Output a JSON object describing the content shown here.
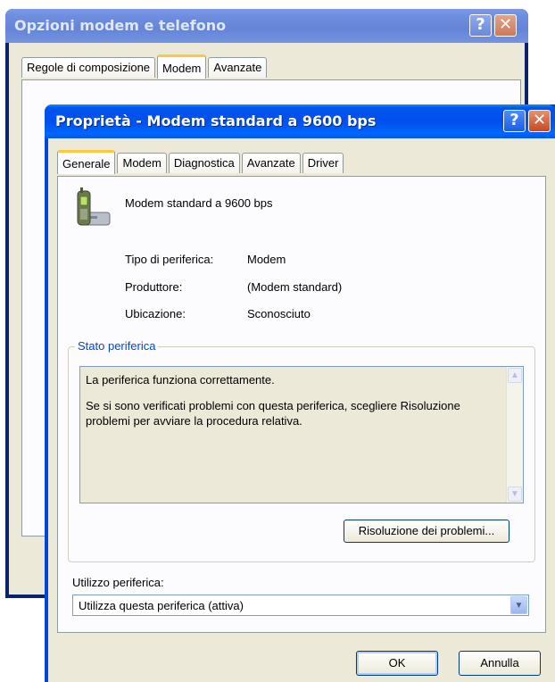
{
  "back_window": {
    "title": "Opzioni modem e telefono",
    "help_glyph": "?",
    "close_glyph": "✕",
    "tabs": [
      "Regole di composizione",
      "Modem",
      "Avanzate"
    ],
    "active_tab": "Modem"
  },
  "dialog": {
    "title": "Proprietà - Modem standard a 9600 bps",
    "help_glyph": "?",
    "close_glyph": "✕",
    "tabs": [
      "Generale",
      "Modem",
      "Diagnostica",
      "Avanzate",
      "Driver"
    ],
    "active_tab": "Generale",
    "device_icon": "modem-phone-icon",
    "device_name": "Modem standard a 9600 bps",
    "properties": [
      {
        "label": "Tipo di periferica:",
        "value": "Modem"
      },
      {
        "label": "Produttore:",
        "value": "(Modem standard)"
      },
      {
        "label": "Ubicazione:",
        "value": "Sconosciuto"
      }
    ],
    "status_group": {
      "title": "Stato periferica",
      "line1": "La periferica funziona correttamente.",
      "line2": "Se si sono verificati problemi con questa periferica, scegliere Risoluzione problemi per avviare la procedura relativa."
    },
    "troubleshoot_button": "Risoluzione dei problemi...",
    "usage_label": "Utilizzo periferica:",
    "usage_value": "Utilizza questa periferica (attiva)",
    "ok_button": "OK",
    "cancel_button": "Annulla"
  },
  "colors": {
    "titlebar_active": "#0054e3",
    "titlebar_inactive": "#7a96df",
    "dialog_face": "#ece9d8",
    "group_title": "#0046d5",
    "active_tab_accent": "#ffc83c"
  }
}
